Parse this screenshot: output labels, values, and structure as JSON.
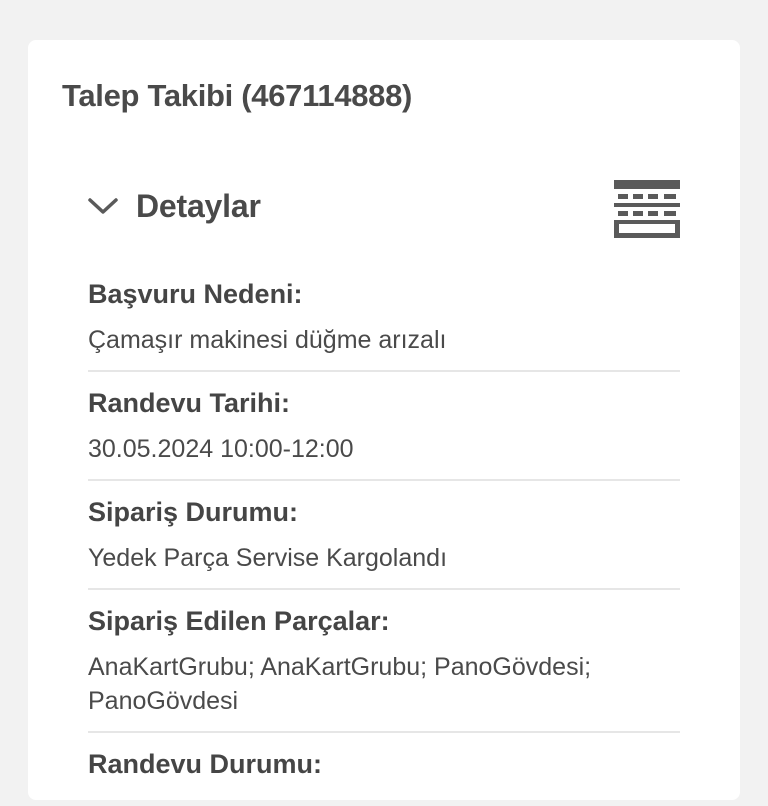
{
  "page": {
    "title": "Talep Takibi (467114888)"
  },
  "section": {
    "title": "Detaylar",
    "expanded": true,
    "chevron_icon": "chevron-down-icon",
    "table_icon": "table-grid-icon"
  },
  "details": [
    {
      "label": "Başvuru Nedeni:",
      "value": "Çamaşır makinesi düğme arızalı"
    },
    {
      "label": "Randevu Tarihi:",
      "value": "30.05.2024 10:00-12:00"
    },
    {
      "label": "Sipariş Durumu:",
      "value": "Yedek Parça Servise Kargolandı"
    },
    {
      "label": "Sipariş Edilen Parçalar:",
      "value": "AnaKartGrubu; AnaKartGrubu; PanoGövdesi; PanoGövdesi"
    },
    {
      "label": "Randevu Durumu:",
      "value": ""
    }
  ],
  "colors": {
    "background": "#f2f2f2",
    "card": "#ffffff",
    "text": "#4a4a4a",
    "icon": "#5a5a5a",
    "divider": "#e6e6e6"
  }
}
